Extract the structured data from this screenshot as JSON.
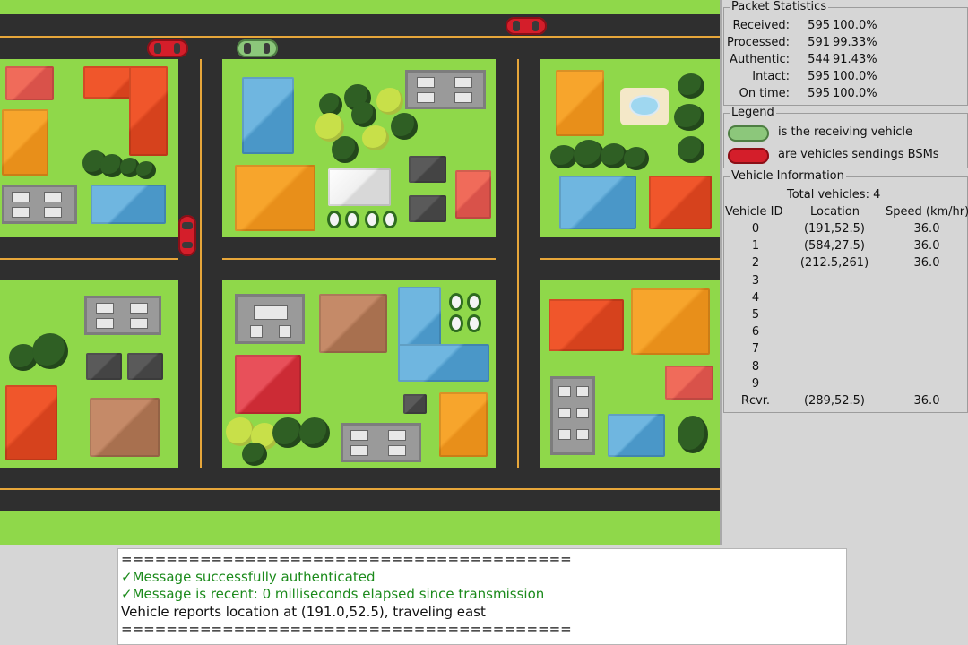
{
  "packet_statistics": {
    "title": "Packet Statistics",
    "rows": [
      {
        "label": "Received:",
        "count": "595",
        "percent": "100.0%"
      },
      {
        "label": "Processed:",
        "count": "591",
        "percent": "99.33%"
      },
      {
        "label": "Authentic:",
        "count": "544",
        "percent": "91.43%"
      },
      {
        "label": "Intact:",
        "count": "595",
        "percent": "100.0%"
      },
      {
        "label": "On time:",
        "count": "595",
        "percent": "100.0%"
      }
    ]
  },
  "legend": {
    "title": "Legend",
    "receiving_text": "is the receiving vehicle",
    "sending_text": "are vehicles sendings BSMs",
    "receiving_color": "#8cc77b",
    "sending_color": "#d41e2a"
  },
  "vehicle_information": {
    "title": "Vehicle Information",
    "total_label": "Total vehicles: 4",
    "headers": {
      "id": "Vehicle ID",
      "location": "Location",
      "speed": "Speed (km/hr)"
    },
    "rows": [
      {
        "id": "0",
        "location": "(191,52.5)",
        "speed": "36.0"
      },
      {
        "id": "1",
        "location": "(584,27.5)",
        "speed": "36.0"
      },
      {
        "id": "2",
        "location": "(212.5,261)",
        "speed": "36.0"
      },
      {
        "id": "3",
        "location": "",
        "speed": ""
      },
      {
        "id": "4",
        "location": "",
        "speed": ""
      },
      {
        "id": "5",
        "location": "",
        "speed": ""
      },
      {
        "id": "6",
        "location": "",
        "speed": ""
      },
      {
        "id": "7",
        "location": "",
        "speed": ""
      },
      {
        "id": "8",
        "location": "",
        "speed": ""
      },
      {
        "id": "9",
        "location": "",
        "speed": ""
      },
      {
        "id": "Rcvr.",
        "location": "(289,52.5)",
        "speed": "36.0"
      }
    ]
  },
  "console": {
    "lines": [
      {
        "text": "========================================",
        "style": "black"
      },
      {
        "text": "✓Message successfully authenticated",
        "style": "green"
      },
      {
        "text": "✓Message is recent: 0 milliseconds elapsed since transmission",
        "style": "green"
      },
      {
        "text": "Vehicle reports location at (191.0,52.5), traveling east",
        "style": "black"
      },
      {
        "text": "========================================",
        "style": "black"
      }
    ]
  }
}
